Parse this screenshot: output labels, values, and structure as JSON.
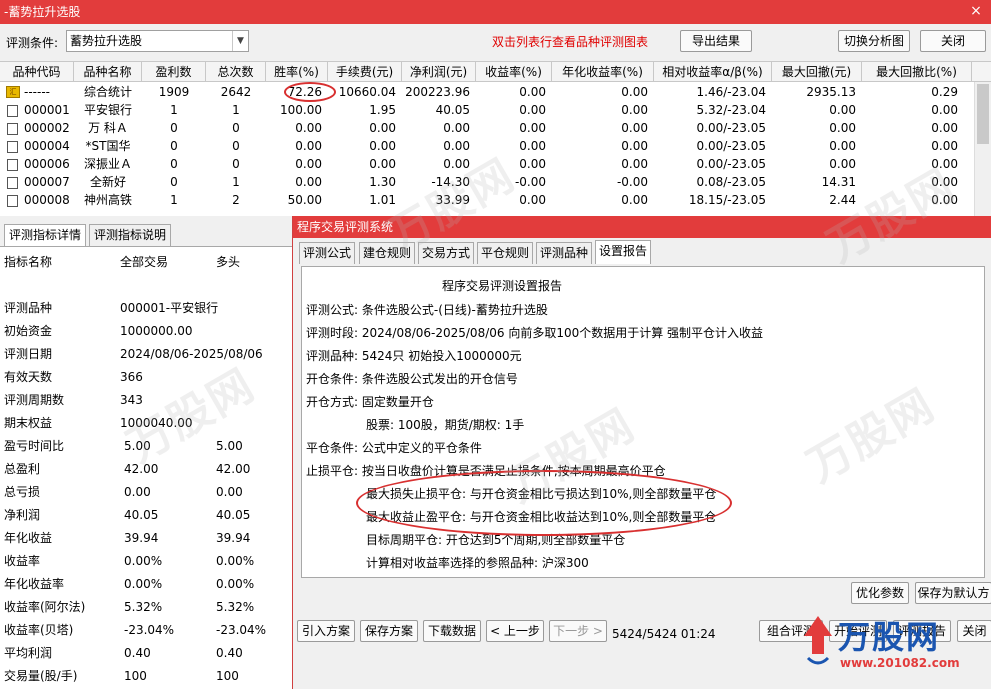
{
  "window": {
    "title": "-蓄势拉升选股",
    "close_icon": "×"
  },
  "toolbar": {
    "condition_label": "评测条件:",
    "condition_value": "蓄势拉升选股",
    "hint": "双击列表行查看品种评测图表",
    "export_label": "导出结果",
    "switch_label": "切换分析图",
    "close_label": "关闭"
  },
  "grid": {
    "columns": [
      "品种代码",
      "品种名称",
      "盈利数",
      "总次数",
      "胜率(%)",
      "手续费(元)",
      "净利润(元)",
      "收益率(%)",
      "年化收益率(%)",
      "相对收益率α/β(%)",
      "最大回撤(元)",
      "最大回撤比(%)"
    ],
    "rows": [
      {
        "code": "------",
        "name": "综合统计",
        "win": "1909",
        "total": "2642",
        "winrate": "72.26",
        "fee": "10660.04",
        "profit": "200223.96",
        "ret": "0.00",
        "annual": "0.00",
        "rel": "1.46/-23.04",
        "dd": "2935.13",
        "ddr": "0.29"
      },
      {
        "code": "000001",
        "name": "平安银行",
        "win": "1",
        "total": "1",
        "winrate": "100.00",
        "fee": "1.95",
        "profit": "40.05",
        "ret": "0.00",
        "annual": "0.00",
        "rel": "5.32/-23.04",
        "dd": "0.00",
        "ddr": "0.00"
      },
      {
        "code": "000002",
        "name": "万 科Ａ",
        "win": "0",
        "total": "0",
        "winrate": "0.00",
        "fee": "0.00",
        "profit": "0.00",
        "ret": "0.00",
        "annual": "0.00",
        "rel": "0.00/-23.05",
        "dd": "0.00",
        "ddr": "0.00"
      },
      {
        "code": "000004",
        "name": "*ST国华",
        "win": "0",
        "total": "0",
        "winrate": "0.00",
        "fee": "0.00",
        "profit": "0.00",
        "ret": "0.00",
        "annual": "0.00",
        "rel": "0.00/-23.05",
        "dd": "0.00",
        "ddr": "0.00"
      },
      {
        "code": "000006",
        "name": "深振业Ａ",
        "win": "0",
        "total": "0",
        "winrate": "0.00",
        "fee": "0.00",
        "profit": "0.00",
        "ret": "0.00",
        "annual": "0.00",
        "rel": "0.00/-23.05",
        "dd": "0.00",
        "ddr": "0.00"
      },
      {
        "code": "000007",
        "name": "全新好",
        "win": "0",
        "total": "1",
        "winrate": "0.00",
        "fee": "1.30",
        "profit": "-14.30",
        "ret": "-0.00",
        "annual": "-0.00",
        "rel": "0.08/-23.05",
        "dd": "14.31",
        "ddr": "0.00"
      },
      {
        "code": "000008",
        "name": "神州高铁",
        "win": "1",
        "total": "2",
        "winrate": "50.00",
        "fee": "1.01",
        "profit": "33.99",
        "ret": "0.00",
        "annual": "0.00",
        "rel": "18.15/-23.05",
        "dd": "2.44",
        "ddr": "0.00"
      }
    ]
  },
  "left_panel": {
    "tabs": [
      "评测指标详情",
      "评测指标说明"
    ],
    "header": [
      "指标名称",
      "全部交易",
      "多头"
    ],
    "rows": [
      {
        "name": "评测品种",
        "all": "000001-平安银行",
        "long": ""
      },
      {
        "name": "初始资金",
        "all": "1000000.00",
        "long": ""
      },
      {
        "name": "评测日期",
        "all": "2024/08/06-2025/08/06",
        "long": ""
      },
      {
        "name": "有效天数",
        "all": "366",
        "long": ""
      },
      {
        "name": "评测周期数",
        "all": "343",
        "long": ""
      },
      {
        "name": "期末权益",
        "all": "1000040.00",
        "long": ""
      },
      {
        "name": "盈亏时间比",
        "all": "5.00",
        "long": "5.00"
      },
      {
        "name": "总盈利",
        "all": "42.00",
        "long": "42.00"
      },
      {
        "name": "总亏损",
        "all": "0.00",
        "long": "0.00"
      },
      {
        "name": "净利润",
        "all": "40.05",
        "long": "40.05"
      },
      {
        "name": "年化收益",
        "all": "39.94",
        "long": "39.94"
      },
      {
        "name": "收益率",
        "all": "0.00%",
        "long": "0.00%"
      },
      {
        "name": "年化收益率",
        "all": "0.00%",
        "long": "0.00%"
      },
      {
        "name": "收益率(阿尔法)",
        "all": "5.32%",
        "long": "5.32%"
      },
      {
        "name": "收益率(贝塔)",
        "all": "-23.04%",
        "long": "-23.04%"
      },
      {
        "name": "平均利润",
        "all": "0.40",
        "long": "0.40"
      },
      {
        "name": "交易量(股/手)",
        "all": "100",
        "long": "100"
      }
    ]
  },
  "dialog": {
    "title": "程序交易评测系统",
    "tabs": [
      "评测公式",
      "建仓规则",
      "交易方式",
      "平仓规则",
      "评测品种",
      "设置报告"
    ],
    "report_title": "程序交易评测设置报告",
    "lines": [
      "评测公式:  条件选股公式-(日线)-蓄势拉升选股",
      "评测时段:  2024/08/06-2025/08/06 向前多取100个数据用于计算 强制平仓计入收益",
      "评测品种:  5424只 初始投入1000000元",
      "开仓条件:  条件选股公式发出的开仓信号",
      "开仓方式:  固定数量开仓",
      "股票: 100股，期货/期权: 1手",
      "平仓条件:  公式中定义的平仓条件",
      "止损平仓:  按当日收盘价计算是否满足止损条件,按本周期最高价平仓",
      "最大损失止损平仓:  与开仓资金相比亏损达到10%,则全部数量平仓",
      "最大收益止盈平仓:  与开仓资金相比收益达到10%,则全部数量平仓",
      "目标周期平仓:  开仓达到5个周期,则全部数量平仓",
      "计算相对收益率选择的参照品种:  沪深300"
    ],
    "buttons": {
      "optimize": "优化参数",
      "save_default": "保存为默认方",
      "import": "引入方案",
      "save_plan": "保存方案",
      "download": "下载数据",
      "prev": "< 上一步",
      "next": "下一步 >",
      "combine": "组合评测",
      "start": "开始评测",
      "report": "评测报告",
      "close": "关闭"
    },
    "status": "5424/5424  01:24"
  },
  "watermark": {
    "text": "万股网",
    "logo_text": "万股网",
    "logo_url": "www.201082.com"
  },
  "colors": {
    "title_bar": "#e23c3c",
    "hint": "#e00000",
    "annotation": "#d83030"
  }
}
